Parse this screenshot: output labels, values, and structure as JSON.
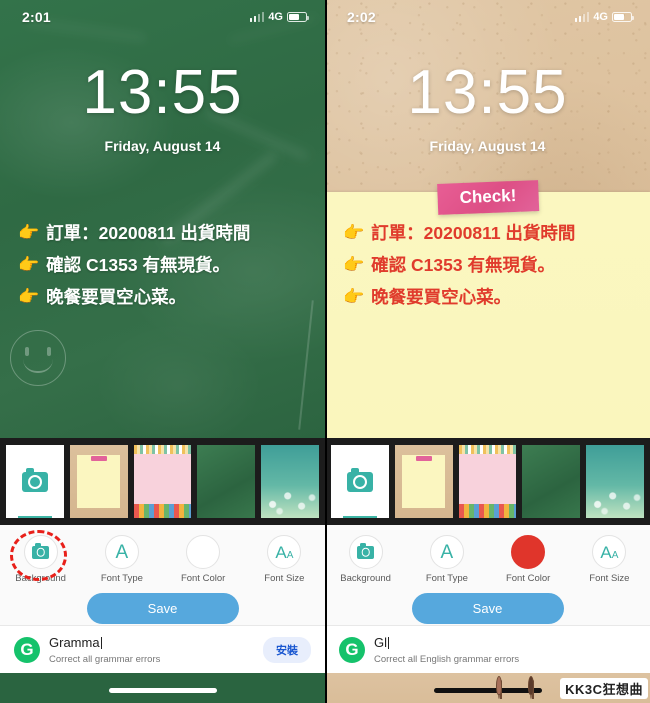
{
  "panels": [
    {
      "id": "before",
      "status": {
        "time": "2:01",
        "network": "4G"
      },
      "lockscreen": {
        "clock": "13:55",
        "date": "Friday, August 14"
      },
      "sticker": null,
      "note_lines": [
        {
          "icon": "pointing-hand",
          "text": "訂單：20200811 出貨時間"
        },
        {
          "icon": "pointing-hand",
          "text": "確認 C1353 有無現貨。"
        },
        {
          "icon": "pointing-hand",
          "text": "晚餐要買空心菜。"
        }
      ],
      "note_text_color": "#ffffff",
      "background_style": "chalkboard-green",
      "thumbnails": [
        {
          "name": "camera-custom",
          "type": "camera"
        },
        {
          "name": "cork-memo",
          "type": "cork"
        },
        {
          "name": "pink-candy",
          "type": "pink"
        },
        {
          "name": "green-board",
          "type": "board"
        },
        {
          "name": "teal-bokeh",
          "type": "teal"
        }
      ],
      "selected_thumbnail": 0,
      "tools": [
        {
          "label": "Background",
          "icon": "camera-icon",
          "state": "default"
        },
        {
          "label": "Font Type",
          "icon": "letter-a-icon",
          "state": "default"
        },
        {
          "label": "Font Color",
          "icon": "empty-circle-icon",
          "state": "default"
        },
        {
          "label": "Font Size",
          "icon": "letter-aa-icon",
          "state": "default"
        }
      ],
      "save_label": "Save",
      "annotation": {
        "shape": "dashed-circle",
        "color": "#e8201a",
        "target": "Background"
      },
      "ad": {
        "logo": "G",
        "title": "Gramma",
        "subtitle": "Correct all grammar errors",
        "button": "安裝"
      },
      "home_indicator": "light"
    },
    {
      "id": "after",
      "status": {
        "time": "2:02",
        "network": "4G"
      },
      "lockscreen": {
        "clock": "13:55",
        "date": "Friday, August 14"
      },
      "sticker": {
        "text": "Check!",
        "color": "#dd4f85"
      },
      "note_lines": [
        {
          "icon": "pointing-hand",
          "text": "訂單：20200811 出貨時間"
        },
        {
          "icon": "pointing-hand",
          "text": "確認 C1353 有無現貨。"
        },
        {
          "icon": "pointing-hand",
          "text": "晚餐要買空心菜。"
        }
      ],
      "note_text_color": "#e03b2c",
      "background_style": "cork-yellow-memo",
      "thumbnails": [
        {
          "name": "camera-custom",
          "type": "camera"
        },
        {
          "name": "cork-memo",
          "type": "cork"
        },
        {
          "name": "pink-candy",
          "type": "pink"
        },
        {
          "name": "green-board",
          "type": "board"
        },
        {
          "name": "teal-bokeh",
          "type": "teal"
        }
      ],
      "selected_thumbnail": 0,
      "tools": [
        {
          "label": "Background",
          "icon": "camera-icon",
          "state": "default"
        },
        {
          "label": "Font Type",
          "icon": "letter-a-icon",
          "state": "default"
        },
        {
          "label": "Font Color",
          "icon": "filled-circle-icon",
          "state": "active",
          "color": "#e0352b"
        },
        {
          "label": "Font Size",
          "icon": "letter-aa-icon",
          "state": "default"
        }
      ],
      "save_label": "Save",
      "annotation": null,
      "ad": {
        "logo": "G",
        "title": "Gl",
        "subtitle": "Correct all English grammar errors",
        "button": null
      },
      "home_indicator": "dark"
    }
  ],
  "watermark": {
    "text": "KK3C狂想曲"
  },
  "icons": {
    "hand": "👉"
  }
}
